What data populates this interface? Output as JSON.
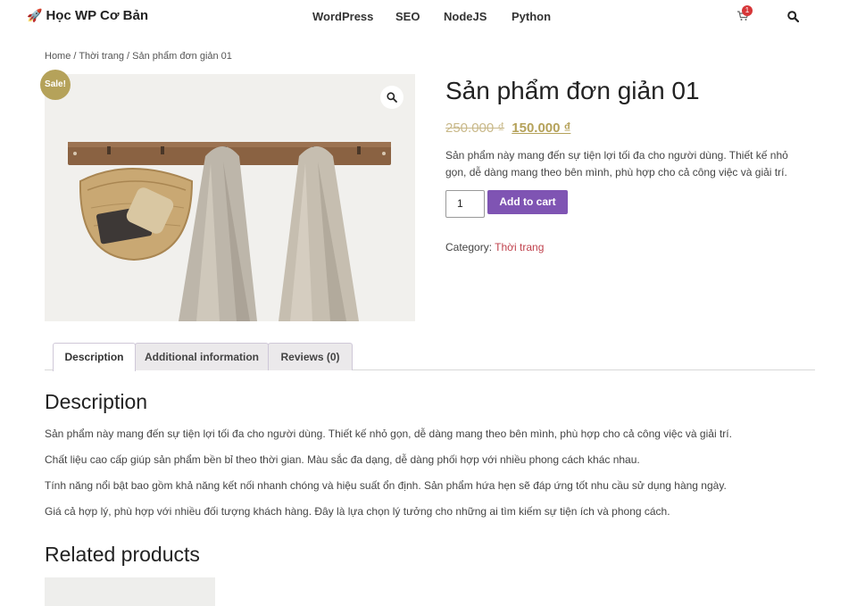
{
  "header": {
    "logo_text": "Học WP Cơ Bản",
    "logo_icon": "rocket-icon",
    "nav": [
      "WordPress",
      "SEO",
      "NodeJS",
      "Python"
    ],
    "cart_count": "1",
    "cart_icon": "cart-icon",
    "search_icon": "search-icon"
  },
  "breadcrumb": {
    "home": "Home",
    "category": "Thời trang",
    "current": "Sản phẩm đơn giản 01",
    "sep": " / "
  },
  "product": {
    "sale_badge": "Sale!",
    "title": "Sản phẩm đơn giản 01",
    "price_old": "250.000 ₫",
    "price_new": "150.000 ₫",
    "short_description": "Sản phẩm này mang đến sự tiện lợi tối đa cho người dùng. Thiết kế nhỏ gọn, dễ dàng mang theo bên mình, phù hợp cho cả công việc và giải trí.",
    "quantity": "1",
    "add_to_cart": "Add to cart",
    "category_label": "Category: ",
    "category_value": "Thời trang",
    "accent_color": "#7f54b3",
    "sale_color": "#b5a25a"
  },
  "tabs": {
    "description": "Description",
    "additional": "Additional information",
    "reviews": "Reviews (0)"
  },
  "description": {
    "heading": "Description",
    "paragraphs": [
      "Sản phẩm này mang đến sự tiện lợi tối đa cho người dùng. Thiết kế nhỏ gọn, dễ dàng mang theo bên mình, phù hợp cho cả công việc và giải trí.",
      "Chất liệu cao cấp giúp sản phẩm bền bỉ theo thời gian. Màu sắc đa dạng, dễ dàng phối hợp với nhiều phong cách khác nhau.",
      "Tính năng nổi bật bao gồm khả năng kết nối nhanh chóng và hiệu suất ổn định. Sản phẩm hứa hẹn sẽ đáp ứng tốt nhu cầu sử dụng hàng ngày.",
      "Giá cả hợp lý, phù hợp với nhiều đối tượng khách hàng. Đây là lựa chọn lý tưởng cho những ai tìm kiếm sự tiện ích và phong cách."
    ]
  },
  "related": {
    "heading": "Related products"
  }
}
